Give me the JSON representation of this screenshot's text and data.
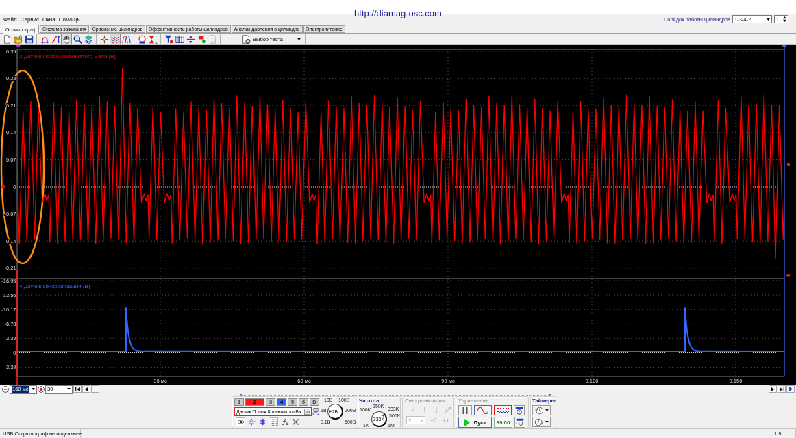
{
  "header": {
    "url": "http://diamag-osc.com",
    "menu": [
      "Файл",
      "Сервис",
      "Окна",
      "Помощь"
    ],
    "cylinder_order": {
      "label": "Порядок работы цилиндров",
      "value": "1-3-4-2",
      "spin_value": "1"
    }
  },
  "tabs": [
    {
      "label": "Осциллограф",
      "selected": true
    },
    {
      "label": "Система зажигания",
      "selected": false
    },
    {
      "label": "Сравнение цилиндров",
      "selected": false
    },
    {
      "label": "Эффективность работы цилиндров",
      "selected": false
    },
    {
      "label": "Анализ давления в цилиндре",
      "selected": false
    },
    {
      "label": "Электропитание",
      "selected": false
    }
  ],
  "toolbar": {
    "tools": [
      {
        "selected": false
      },
      {
        "selected": false
      },
      {
        "selected": false
      },
      {
        "selected": false
      },
      {
        "selected": false
      },
      {
        "selected": true
      },
      {
        "selected": false
      },
      {
        "selected": false
      },
      {
        "selected": false
      },
      {
        "selected": true
      },
      {
        "selected": false
      },
      {
        "selected": false
      },
      {
        "selected": false
      },
      {
        "selected": false
      },
      {
        "selected": false
      },
      {
        "selected": false
      },
      {
        "selected": false
      },
      {
        "selected": false
      }
    ],
    "test_select": "Выбор теста"
  },
  "scope": {
    "panels": [
      {
        "title": "2 Датчик Полож Коленчатого Вала (В)",
        "color": "#ff0000",
        "y_ticks": [
          "0.35",
          "0.28",
          "0.21",
          "0.14",
          "0.07",
          "0",
          "-0.07",
          "-0.14",
          "-0.21"
        ]
      },
      {
        "title": "4 Датчик синхронизации (В)",
        "color": "#3366ff",
        "y_ticks": [
          "-16.95",
          "-13.56",
          "-10.17",
          "-6.78",
          "-3.39",
          "0",
          "3.39"
        ]
      }
    ],
    "x_ticks": [
      "30 мс",
      "60 мс",
      "90 мс",
      "0.120",
      "0.150"
    ]
  },
  "timebase": {
    "span": "160 мс",
    "span_highlighted": true,
    "step": "30"
  },
  "controls": {
    "channels": [
      {
        "label": "1",
        "selected": false,
        "current": false
      },
      {
        "label": "2",
        "selected": true,
        "current": true,
        "color": "#ff1a1a"
      },
      {
        "label": "3",
        "selected": false,
        "current": false
      },
      {
        "label": "4",
        "selected": true,
        "current": false,
        "color": "#3366ff"
      },
      {
        "label": "5",
        "selected": false,
        "current": false
      },
      {
        "label": "6",
        "selected": false,
        "current": false
      },
      {
        "label": "D",
        "selected": false,
        "current": false
      }
    ],
    "sensor": "Датчик Полож Коленчатого Ва",
    "display_tools": [
      {
        "selected": true
      },
      {
        "selected": false
      },
      {
        "selected": false
      },
      {
        "selected": true
      },
      {
        "selected": false
      },
      {
        "selected": false
      }
    ],
    "voltage": {
      "scale": [
        "10В",
        "100В",
        "1В",
        "200В",
        "0,1В",
        "500В"
      ],
      "value": "2В"
    },
    "frequency": {
      "title": "Частота",
      "scale": [
        "100K",
        "250K",
        "333K",
        "500K",
        "1K",
        "1M"
      ],
      "value": "333K"
    },
    "sync": {
      "title": "Синхронизация",
      "disabled": true,
      "channel": "2"
    },
    "control": {
      "title": "Управление",
      "disabled": true,
      "start": "Пуск",
      "reading": "39.00"
    },
    "timers": {
      "title": "Таймеры"
    }
  },
  "status_bar": {
    "message": "USB Осциллограф не подключен",
    "version": "1.9"
  }
}
